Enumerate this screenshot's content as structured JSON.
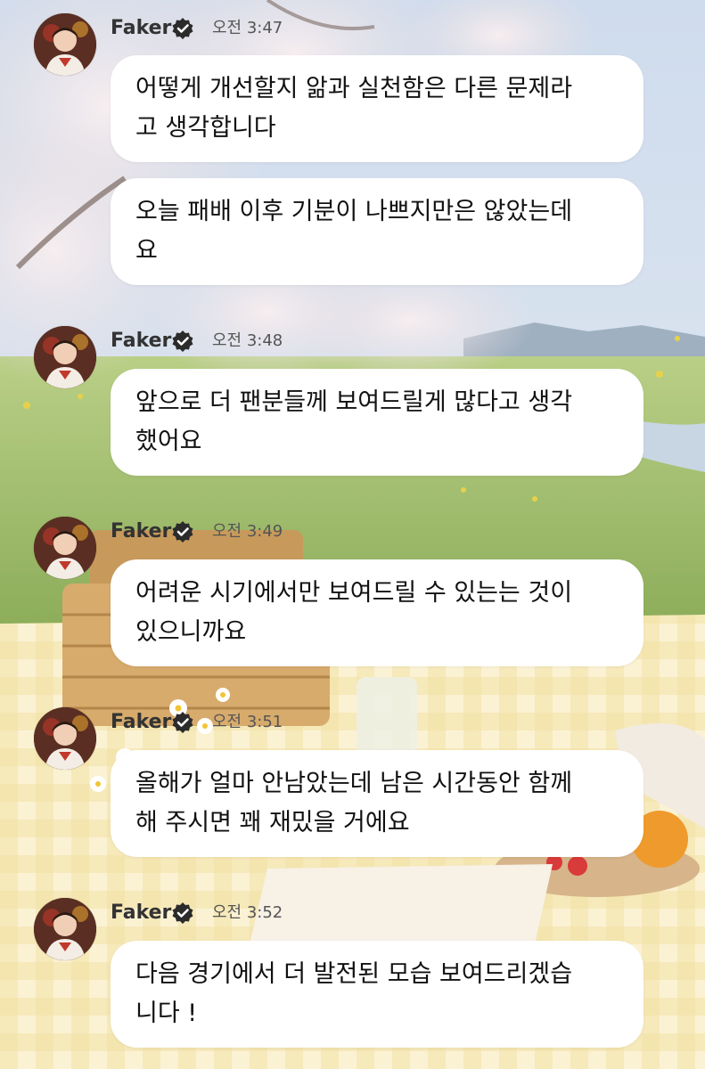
{
  "messages": [
    {
      "sender": "Faker",
      "time": "오전 3:47",
      "texts": [
        [
          "어떻게 개선할지 앎과 실천함은 다른 문제라",
          "고 생각합니다"
        ],
        [
          "오늘 패배 이후 기분이 나쁘지만은 않았는데",
          "요"
        ]
      ]
    },
    {
      "sender": "Faker",
      "time": "오전 3:48",
      "texts": [
        [
          "앞으로 더 팬분들께 보여드릴게 많다고 생각",
          "했어요"
        ]
      ]
    },
    {
      "sender": "Faker",
      "time": "오전 3:49",
      "texts": [
        [
          "어려운 시기에서만 보여드릴 수 있는는 것이",
          "있으니까요"
        ]
      ]
    },
    {
      "sender": "Faker",
      "time": "오전 3:51",
      "texts": [
        [
          "올해가 얼마 안남았는데 남은 시간동안 함께",
          "해 주시면 꽤 재밌을 거에요"
        ]
      ]
    },
    {
      "sender": "Faker",
      "time": "오전 3:52",
      "texts": [
        [
          "다음 경기에서 더 발전된 모습 보여드리겠습",
          "니다 !"
        ]
      ]
    }
  ],
  "icons": {
    "verified": "verified-badge-icon",
    "avatar": "profile-avatar"
  },
  "colors": {
    "bubble": "#ffffff",
    "text": "#111111",
    "name": "#333333",
    "time": "#555555",
    "badge": "#2b2b2b"
  }
}
